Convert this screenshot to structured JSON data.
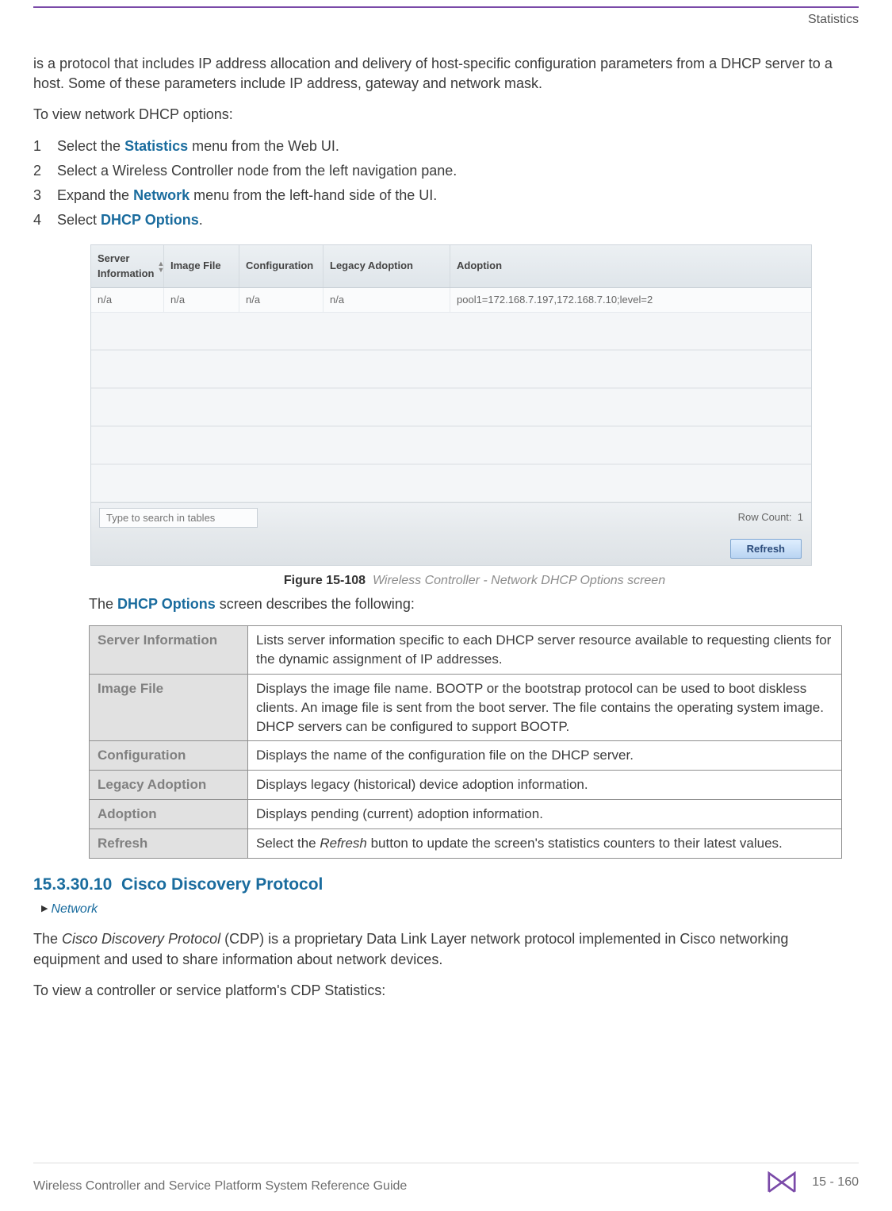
{
  "header": {
    "section": "Statistics"
  },
  "intro": "is a protocol that includes IP address allocation and delivery of host-specific configuration parameters from a DHCP server to a host. Some of these parameters include IP address, gateway and network mask.",
  "lead": "To view network DHCP options:",
  "steps": [
    {
      "n": "1",
      "pre": "Select the ",
      "kw": "Statistics",
      "post": " menu from the Web UI."
    },
    {
      "n": "2",
      "pre": "Select a Wireless Controller node from the left navigation pane.",
      "kw": "",
      "post": ""
    },
    {
      "n": "3",
      "pre": "Expand the ",
      "kw": "Network",
      "post": " menu from the left-hand side of the UI."
    },
    {
      "n": "4",
      "pre": "Select ",
      "kw": "DHCP Options",
      "post": "."
    }
  ],
  "screenshot": {
    "headers": [
      "Server Information",
      "Image File",
      "Configuration",
      "Legacy Adoption",
      "Adoption"
    ],
    "row": [
      "n/a",
      "n/a",
      "n/a",
      "n/a",
      "pool1=172.168.7.197,172.168.7.10;level=2"
    ],
    "search_placeholder": "Type to search in tables",
    "rowcount_label": "Row Count:",
    "rowcount_value": "1",
    "refresh": "Refresh"
  },
  "figure": {
    "num": "Figure 15-108",
    "caption": "Wireless Controller - Network DHCP Options screen"
  },
  "desc_lead_pre": "The ",
  "desc_lead_kw": "DHCP Options",
  "desc_lead_post": " screen describes the following:",
  "table": [
    {
      "k": "Server Information",
      "v": "Lists server information specific to each DHCP server resource available to requesting clients for the dynamic assignment of IP addresses."
    },
    {
      "k": "Image File",
      "v": "Displays the image file name. BOOTP or the bootstrap protocol can be used to boot diskless clients. An image file is sent from the boot server. The file contains the operating system image. DHCP servers can be configured to support BOOTP."
    },
    {
      "k": "Configuration",
      "v": "Displays the name of the configuration file on the DHCP server."
    },
    {
      "k": "Legacy Adoption",
      "v": "Displays legacy (historical) device adoption information."
    },
    {
      "k": "Adoption",
      "v": "Displays pending (current) adoption information."
    },
    {
      "k": "Refresh",
      "v_pre": "Select the ",
      "v_em": "Refresh",
      "v_post": " button to update the screen's statistics counters to their latest values."
    }
  ],
  "section": {
    "num": "15.3.30.10",
    "title": "Cisco Discovery Protocol",
    "crumb": "Network"
  },
  "cdp_p1_pre": "The ",
  "cdp_p1_em": "Cisco Discovery Protocol",
  "cdp_p1_post": " (CDP) is a proprietary Data Link Layer network protocol implemented in Cisco networking equipment and used to share information about network devices.",
  "cdp_p2": "To view a controller or service platform's CDP Statistics:",
  "footer": {
    "title": "Wireless Controller and Service Platform System Reference Guide",
    "page": "15 - 160"
  }
}
